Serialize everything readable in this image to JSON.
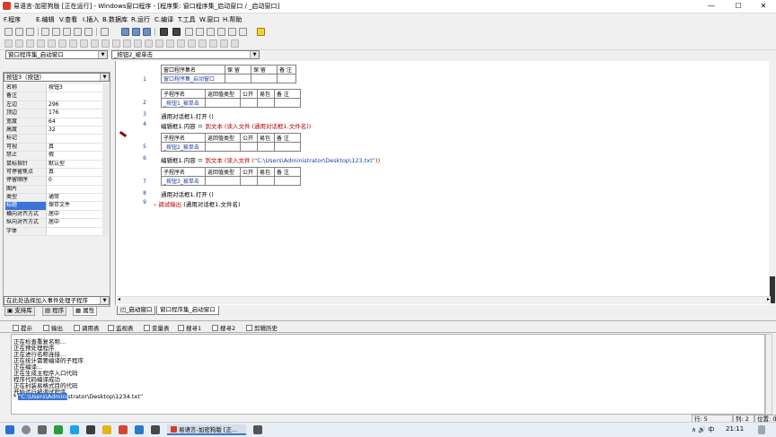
{
  "window": {
    "title": "易语言-加密狗版 [正在运行] - Windows窗口程序 - [程序集: 窗口程序集_启动窗口 / _启动窗口]",
    "min": "—",
    "max": "☐",
    "close": "✕"
  },
  "menu": {
    "items": [
      "F.程序",
      "E.编辑",
      "V.查看",
      "I.插入",
      "B.数据库",
      "R.运行",
      "C.编译",
      "T.工具",
      "W.窗口",
      "H.帮助"
    ]
  },
  "selectors": {
    "left": "窗口程序集_启动窗口",
    "right": "_按钮2_被单击"
  },
  "props": {
    "component": "按钮3（按钮）",
    "rows": [
      {
        "name": "名称",
        "value": "按钮3"
      },
      {
        "name": "备注",
        "value": ""
      },
      {
        "name": "左边",
        "value": "296"
      },
      {
        "name": "顶边",
        "value": "176"
      },
      {
        "name": "宽度",
        "value": "64"
      },
      {
        "name": "高度",
        "value": "32"
      },
      {
        "name": "标记",
        "value": ""
      },
      {
        "name": "可视",
        "value": "真"
      },
      {
        "name": "禁止",
        "value": "假"
      },
      {
        "name": "鼠标指针",
        "value": "默认型"
      },
      {
        "name": "可停留焦点",
        "value": "真"
      },
      {
        "name": "停留顺序",
        "value": "0"
      },
      {
        "name": "图片",
        "value": ""
      },
      {
        "name": "类型",
        "value": "通常"
      },
      {
        "name": "标题",
        "value": "保存文件"
      },
      {
        "name": "横向对齐方式",
        "value": "居中"
      },
      {
        "name": "纵向对齐方式",
        "value": "居中"
      },
      {
        "name": "字体",
        "value": ""
      }
    ],
    "event_prompt": "在此处选择加入事件处理子程序",
    "tabs": [
      "支持库",
      "程序",
      "属性"
    ]
  },
  "code": {
    "assembly_header": {
      "cols": [
        "窗口程序集名",
        "保 留",
        "保 留",
        "备 注"
      ],
      "name": "窗口程序集_启动窗口"
    },
    "sub_header_cols": [
      "子程序名",
      "返回值类型",
      "公开",
      "易包",
      "备 注"
    ],
    "subs": [
      "_按钮1_被单击",
      "_按钮2_被单击",
      "_按钮3_被单击"
    ],
    "line_numbers": [
      "1",
      "2",
      "3",
      "4",
      "5",
      "6",
      "7",
      "8",
      "9"
    ],
    "line3": "通用对话框1.打开 ()",
    "line4_a": "编辑框1.内容 ＝ ",
    "line4_b": "到文本 (读入文件 (通用对话框1.文件名))",
    "line6_a": "编辑框1.内容 ＝ ",
    "line6_b": "到文本 (读入文件 (",
    "line6_c": "“C:\\Users\\Administrator\\Desktop\\123.txt”",
    "line6_d": "))",
    "line8": "通用对话框1.打开 ()",
    "line9_a": "调试输出",
    "line9_b": " (通用对话框1.文件名)"
  },
  "editor_tabs": [
    "_启动窗口",
    "窗口程序集_启动窗口"
  ],
  "output": {
    "tabs": [
      "提示",
      "输出",
      "调用表",
      "监视表",
      "变量表",
      "搜寻1",
      "搜寻2",
      "剪辑历史"
    ],
    "lines": [
      "正在检查重复名称...",
      "正在预处理程序",
      "正在进行名称连接...",
      "正在统计需要编译的子程序",
      "正在编译...",
      "正在生成主程序入口代码",
      "程序代码编译成功",
      "正在封装易格式目的代码",
      "开始运行被调试程序"
    ],
    "last_prefix": "* ",
    "last_highlight": "“C:\\Users\\Admini",
    "last_rest": "strator\\Desktop\\1234.txt”"
  },
  "status": {
    "line": "行: 5",
    "col": "列: 2",
    "pos": "位置: 0"
  },
  "taskbar": {
    "app": "易语言-加密狗版 [正...",
    "time": "21:11",
    "tray": "∧ 🔊 中"
  }
}
